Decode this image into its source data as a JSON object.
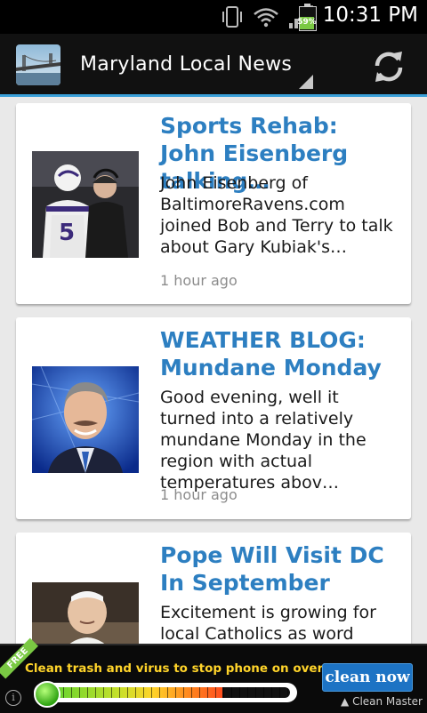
{
  "status_bar": {
    "time": "10:31 PM",
    "battery_percent_label": "59%",
    "battery_level": 0.59,
    "icons": [
      "vibrate-icon",
      "wifi-icon",
      "signal-icon",
      "battery-icon"
    ]
  },
  "action_bar": {
    "title": "Maryland Local News",
    "app_icon": "bridge-thumbnail-icon",
    "refresh_icon": "refresh-icon",
    "accent_color": "#3aa0d9"
  },
  "articles": [
    {
      "title": "Sports Rehab: John Eisenberg talking…",
      "description": "John Eisenberg of BaltimoreRavens.com joined Bob and Terry to talk about Gary Kubiak's…",
      "time": "1 hour ago"
    },
    {
      "title": "WEATHER BLOG: Mundane Monday",
      "description": "Good evening, well it turned into a relatively mundane Monday in the region with actual temperatures abov…",
      "time": "1 hour ago"
    },
    {
      "title": "Pope Will Visit DC In September",
      "description": "Excitement is growing for local Catholics as word",
      "time": ""
    }
  ],
  "ad": {
    "badge": "FREE",
    "headline": "Clean trash and virus to stop phone on overheat.",
    "button_label": "clean now",
    "brand": "Clean Master",
    "info_glyph": "i",
    "meter_level": 0.72
  },
  "colors": {
    "title_blue": "#2d7fc1",
    "background": "#e9e9e9",
    "ad_yellow": "#ffd42a",
    "ad_button": "#1d73c4"
  }
}
